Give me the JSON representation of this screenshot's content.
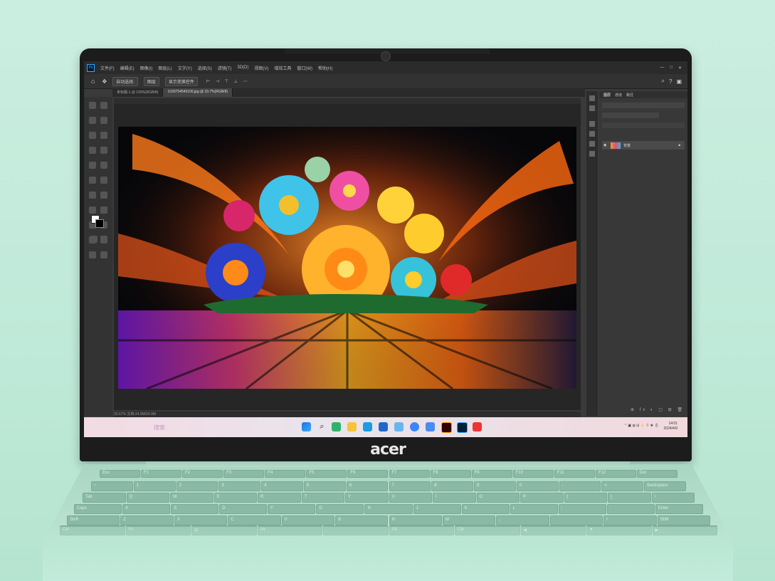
{
  "app": {
    "name": "Photoshop",
    "menus": [
      "文件(F)",
      "编辑(E)",
      "图像(I)",
      "图层(L)",
      "文字(Y)",
      "选择(S)",
      "滤镜(T)",
      "3D(D)",
      "视图(V)",
      "增效工具",
      "窗口(W)",
      "帮助(H)"
    ],
    "options": [
      "自动选择:",
      "图层",
      "显示变换控件"
    ],
    "tabs": [
      {
        "label": "未标题-1 @ 100%(RGB/8)",
        "active": false
      },
      {
        "label": "1030754545100.jpg @ 33.7%(RGB/8)",
        "active": true
      }
    ],
    "status": "33.67%  文档:24.9M/24.9M",
    "panel_tabs": [
      "图层",
      "通道",
      "路径"
    ],
    "layer_name": "背景"
  },
  "taskbar": {
    "search_placeholder": "搜索",
    "time": "14:01",
    "date": "2024/4/9"
  },
  "brand": {
    "logo": "acer"
  },
  "colors": {
    "background": "#c3ebdb",
    "bezel": "#1c1c1d",
    "ps_dark": "#2b2b2b",
    "keyboard": "#8ab9a6"
  },
  "keyboard": {
    "keys_row1": [
      "Esc",
      "F1",
      "F2",
      "F3",
      "F4",
      "F5",
      "F6",
      "F7",
      "F8",
      "F9",
      "F10",
      "F11",
      "F12",
      "Del"
    ],
    "keys_row2": [
      "~",
      "1",
      "2",
      "3",
      "4",
      "5",
      "6",
      "7",
      "8",
      "9",
      "0",
      "-",
      "=",
      "Backspace"
    ],
    "keys_row3": [
      "Tab",
      "Q",
      "W",
      "E",
      "R",
      "T",
      "Y",
      "U",
      "I",
      "O",
      "P",
      "[",
      "]",
      "\\"
    ],
    "keys_row4": [
      "Caps",
      "A",
      "S",
      "D",
      "F",
      "G",
      "H",
      "J",
      "K",
      "L",
      ";",
      "'",
      "Enter"
    ],
    "keys_row5": [
      "Shift",
      "Z",
      "X",
      "C",
      "V",
      "B",
      "N",
      "M",
      ",",
      ".",
      "/",
      "Shift"
    ],
    "keys_row6": [
      "Ctrl",
      "Fn",
      "⊞",
      "Alt",
      "",
      "Alt",
      "Ctrl",
      "◀",
      "▼",
      "▶"
    ]
  }
}
